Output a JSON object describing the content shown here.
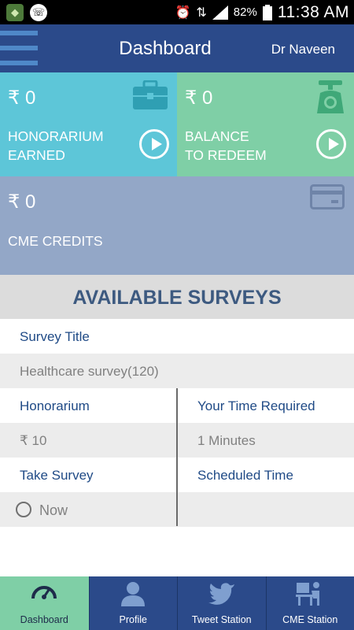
{
  "statusbar": {
    "battery_percent": "82%",
    "time": "11:38 AM",
    "icons": [
      "app-icon",
      "phone-icon",
      "alarm-icon",
      "data-arrows-icon",
      "signal-icon",
      "battery-icon"
    ]
  },
  "appbar": {
    "title": "Dashboard",
    "user": "Dr Naveen"
  },
  "tiles": {
    "honorarium": {
      "amount": "₹ 0",
      "label_line1": "HONORARIUM",
      "label_line2": "EARNED",
      "icon": "briefcase-icon"
    },
    "balance": {
      "amount": "₹ 0",
      "label_line1": "BALANCE",
      "label_line2": "TO REDEEM",
      "icon": "scale-icon"
    },
    "cme": {
      "amount": "₹ 0",
      "label": "CME CREDITS",
      "icon": "card-icon"
    }
  },
  "surveys": {
    "heading": "AVAILABLE SURVEYS",
    "title_label": "Survey Title",
    "title_value": "Healthcare survey(120)",
    "honorarium_label": "Honorarium",
    "honorarium_value": "₹ 10",
    "time_label": "Your Time Required",
    "time_value": "1 Minutes",
    "take_label": "Take Survey",
    "take_option": "Now",
    "scheduled_label": "Scheduled Time",
    "scheduled_value": ""
  },
  "bottom_nav": [
    {
      "label": "Dashboard",
      "icon": "speedometer-icon",
      "active": true
    },
    {
      "label": "Profile",
      "icon": "person-icon",
      "active": false
    },
    {
      "label": "Tweet Station",
      "icon": "twitter-bird-icon",
      "active": false
    },
    {
      "label": "CME Station",
      "icon": "desk-person-icon",
      "active": false
    }
  ],
  "colors": {
    "appbar": "#2b4a8a",
    "honorarium_tile": "#5dc6d8",
    "balance_tile": "#7fcfa6",
    "cme_tile": "#93a7c7",
    "section_text": "#3d5a80",
    "label_text": "#1f4a86"
  }
}
